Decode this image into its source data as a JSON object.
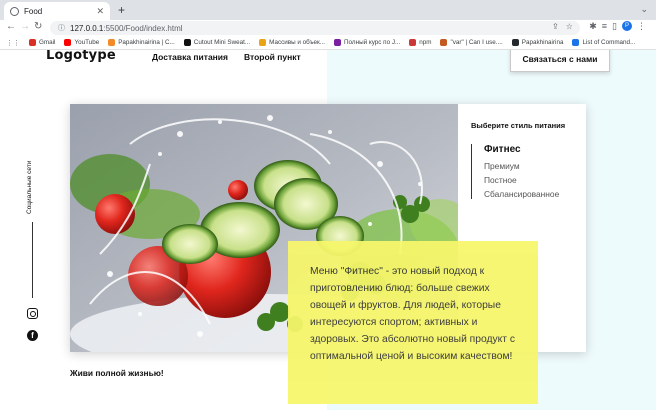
{
  "browser": {
    "tab_title": "Food",
    "new_tab": "+",
    "url_host": "127.0.0.1",
    "url_path": ":5500/Food/index.html",
    "profile_initial": "P",
    "bookmarks": [
      {
        "label": "Gmail",
        "color": "#d93025"
      },
      {
        "label": "YouTube",
        "color": "#ff0000"
      },
      {
        "label": "Papakhinairina | C...",
        "color": "#f28b27"
      },
      {
        "label": "Cutout Mini Sweat...",
        "color": "#111111"
      },
      {
        "label": "Массивы и объек...",
        "color": "#e8a317"
      },
      {
        "label": "Полный курс по J...",
        "color": "#7b1fa2"
      },
      {
        "label": "npm",
        "color": "#cb3837"
      },
      {
        "label": "\"var\" | Can I use....",
        "color": "#c45a1f"
      },
      {
        "label": "Papakhinairina",
        "color": "#24292e"
      },
      {
        "label": "List of Command...",
        "color": "#1a73e8"
      }
    ]
  },
  "header": {
    "logo": "Logotype",
    "nav": [
      "Доставка питания",
      "Второй пункт"
    ],
    "contact_button": "Связаться с нами"
  },
  "social": {
    "label": "Социальные сети",
    "icons": [
      "instagram-icon",
      "facebook-icon"
    ]
  },
  "styles_panel": {
    "title": "Выберите стиль питания",
    "items": [
      {
        "label": "Фитнес",
        "active": true
      },
      {
        "label": "Премиум",
        "active": false
      },
      {
        "label": "Постное",
        "active": false
      },
      {
        "label": "Сбалансированное",
        "active": false
      }
    ]
  },
  "description": "Меню \"Фитнес\" - это новый подход к приготовлению блюд: больше свежих овощей и фруктов. Для людей, которые интересуются спортом; активных и здоровых. Это абсолютно новый продукт с оптимальной ценой и высоким качеством!",
  "tagline": "Живи полной жизнью!",
  "colors": {
    "nav_highlight": "#7ee25c",
    "description_bg": "#f6f66b",
    "right_bg": "#eefbfd"
  }
}
